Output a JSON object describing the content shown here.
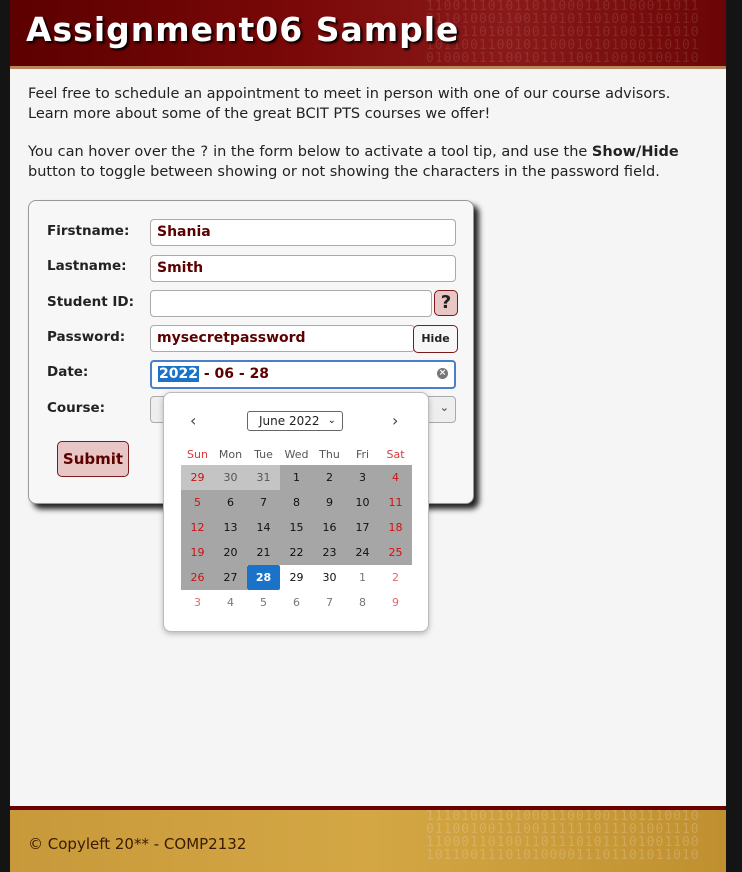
{
  "header": {
    "title": "Assignment06 Sample"
  },
  "intro": {
    "p1": "Feel free to schedule an appointment to meet in person with one of our course advisors. Learn more about some of the great BCIT PTS courses we offer!",
    "p2_a": "You can hover over the ",
    "p2_q": "?",
    "p2_b": " in the form below to activate a tool tip, and use the ",
    "p2_bold": "Show/Hide",
    "p2_c": " button to toggle between showing or not showing the characters in the password field."
  },
  "form": {
    "firstname_label": "Firstname:",
    "firstname_value": "Shania",
    "lastname_label": "Lastname:",
    "lastname_value": "Smith",
    "studentid_label": "Student ID:",
    "studentid_value": "",
    "help_icon": "?",
    "password_label": "Password:",
    "password_value": "mysecretpassword",
    "hide_label": "Hide",
    "date_label": "Date:",
    "date_year": "2022",
    "date_rest": " - 06 - 28",
    "course_label": "Course:",
    "submit_label": "Submit"
  },
  "calendar": {
    "month_label": "June 2022",
    "prev_icon": "chevron-left-icon",
    "next_icon": "chevron-right-icon",
    "weekdays": [
      "Sun",
      "Mon",
      "Tue",
      "Wed",
      "Thu",
      "Fri",
      "Sat"
    ],
    "weeks": [
      [
        "29",
        "30",
        "31",
        "1",
        "2",
        "3",
        "4"
      ],
      [
        "5",
        "6",
        "7",
        "8",
        "9",
        "10",
        "11"
      ],
      [
        "12",
        "13",
        "14",
        "15",
        "16",
        "17",
        "18"
      ],
      [
        "19",
        "20",
        "21",
        "22",
        "23",
        "24",
        "25"
      ],
      [
        "26",
        "27",
        "28",
        "29",
        "30",
        "1",
        "2"
      ],
      [
        "3",
        "4",
        "5",
        "6",
        "7",
        "8",
        "9"
      ]
    ],
    "selected_day": "28"
  },
  "footer": {
    "text": "© Copyleft 20** - COMP2132"
  },
  "colors": {
    "accent": "#5c0000",
    "header": "#7a0808",
    "footer": "#c8993a",
    "selected_day": "#1a73c8"
  }
}
